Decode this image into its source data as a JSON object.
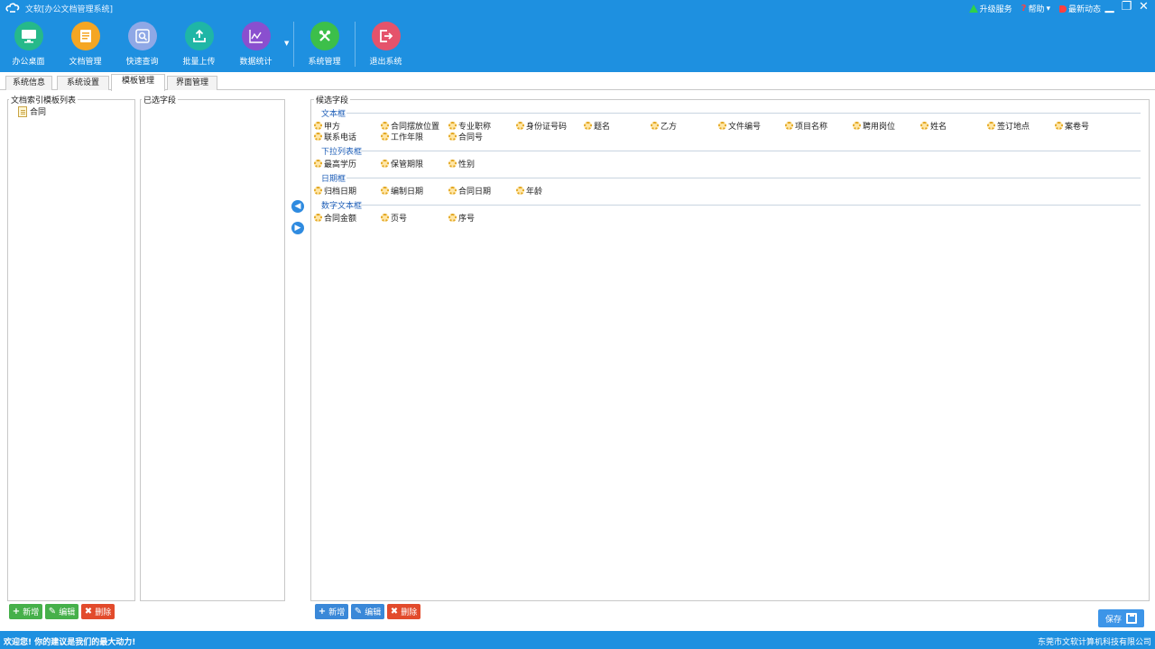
{
  "app": {
    "title": "文软[办公文档管理系统]"
  },
  "header_links": {
    "upgrade": "升级服务",
    "help": "帮助",
    "news": "最新动态"
  },
  "window": {
    "minimize": "▁",
    "restore": "❐",
    "close": "✕"
  },
  "toolbar": [
    {
      "label": "办公桌面",
      "icon": "desktop-icon",
      "color": "#26b98a"
    },
    {
      "label": "文档管理",
      "icon": "document-icon",
      "color": "#f5a623"
    },
    {
      "label": "快速查询",
      "icon": "search-icon",
      "color": "#8fa8e6"
    },
    {
      "label": "批量上传",
      "icon": "upload-icon",
      "color": "#1fb6a6"
    },
    {
      "label": "数据统计",
      "icon": "chart-icon",
      "color": "#8a4fcf"
    },
    {
      "label": "系统管理",
      "icon": "tools-icon",
      "color": "#3cbf4a"
    },
    {
      "label": "退出系统",
      "icon": "exit-icon",
      "color": "#e5536b"
    }
  ],
  "tabs": [
    {
      "label": "系统信息"
    },
    {
      "label": "系统设置"
    },
    {
      "label": "模板管理"
    },
    {
      "label": "界面管理"
    }
  ],
  "left_panel": {
    "title": "文档索引模板列表",
    "items": [
      {
        "label": "合同"
      }
    ]
  },
  "middle_panel": {
    "title": "已选字段"
  },
  "right_panel": {
    "title": "候选字段"
  },
  "groups": [
    {
      "name": "文本框",
      "fields": [
        "甲方",
        "合同摆放位置",
        "专业职称",
        "身份证号码",
        "题名",
        "乙方",
        "文件编号",
        "项目名称",
        "聘用岗位",
        "姓名",
        "签订地点",
        "案卷号",
        "联系电话",
        "工作年限",
        "合同号"
      ]
    },
    {
      "name": "下拉列表框",
      "fields": [
        "最高学历",
        "保管期限",
        "性别"
      ]
    },
    {
      "name": "日期框",
      "fields": [
        "归档日期",
        "编制日期",
        "合同日期",
        "年龄"
      ]
    },
    {
      "name": "数字文本框",
      "fields": [
        "合同金额",
        "页号",
        "序号"
      ]
    }
  ],
  "buttons": {
    "add": "新增",
    "edit": "编辑",
    "delete": "删除",
    "save": "保存"
  },
  "status": {
    "left": "欢迎您! 你的建议是我们的最大动力!",
    "right": "东莞市文软计算机科技有限公司"
  },
  "colors": {
    "brand": "#1e90e0",
    "group_head": "#1f5fb8",
    "add": "#46b04a",
    "edit": "#3a88d8",
    "delete": "#e24b2c"
  }
}
